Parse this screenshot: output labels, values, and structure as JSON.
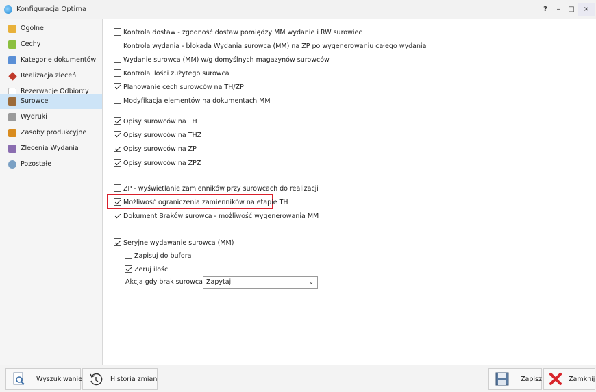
{
  "window": {
    "title": "Konfiguracja Optima",
    "help": "?",
    "minimize": "–",
    "maximize": "□",
    "close": "×"
  },
  "sidebar": {
    "items": [
      {
        "label": "Ogólne",
        "icon": "general-icon",
        "color": "#e8b13a"
      },
      {
        "label": "Cechy",
        "icon": "features-icon",
        "color": "#8bbf3f"
      },
      {
        "label": "Kategorie dokumentów",
        "icon": "document-categories-icon",
        "color": "#5a8fd6"
      },
      {
        "label": "Realizacja zleceń",
        "icon": "tools-icon",
        "color": "#c0392b"
      },
      {
        "label": "Rezerwacje Odbiorcy",
        "icon": "reservation-icon",
        "color": "#cfcfcf"
      },
      {
        "label": "Surowce",
        "icon": "raw-materials-icon",
        "color": "#9b6b3a",
        "active": true
      },
      {
        "label": "Wydruki",
        "icon": "printer-icon",
        "color": "#888"
      },
      {
        "label": "Zasoby produkcyjne",
        "icon": "resources-icon",
        "color": "#d98c1f"
      },
      {
        "label": "Zlecenia Wydania",
        "icon": "release-orders-icon",
        "color": "#8a6db0"
      },
      {
        "label": "Pozostałe",
        "icon": "other-icon",
        "color": "#7aa0c4"
      }
    ]
  },
  "options": [
    {
      "label": "Kontrola dostaw - zgodność dostaw pomiędzy MM wydanie i RW surowiec",
      "checked": false
    },
    {
      "label": "Kontrola wydania - blokada Wydania surowca (MM) na ZP po wygenerowaniu całego wydania",
      "checked": false
    },
    {
      "label": "Wydanie surowca (MM) w/g domyślnych magazynów surowców",
      "checked": false
    },
    {
      "label": "Kontrola ilości zużytego surowca",
      "checked": false
    },
    {
      "label": "Planowanie cech surowców na TH/ZP",
      "checked": true
    },
    {
      "label": "Modyfikacja elementów na dokumentach MM",
      "checked": false
    },
    {
      "label": "Opisy surowców na TH",
      "checked": true
    },
    {
      "label": "Opisy surowców na THZ",
      "checked": true
    },
    {
      "label": "Opisy surowców na ZP",
      "checked": true
    },
    {
      "label": "Opisy surowców na ZPZ",
      "checked": true
    },
    {
      "label": "ZP - wyświetlanie zamienników przy surowcach do realizacji",
      "checked": false
    },
    {
      "label": "Możliwość ograniczenia zamienników na etapie TH",
      "checked": true
    },
    {
      "label": "Dokument Braków surowca - możliwość wygenerowania MM",
      "checked": true
    },
    {
      "label": "Seryjne wydawanie surowca (MM)",
      "checked": true
    },
    {
      "label": "Zapisuj do bufora",
      "checked": false
    },
    {
      "label": "Zeruj ilości",
      "checked": true
    }
  ],
  "missing_action": {
    "label": "Akcja gdy brak surowca:",
    "value": "Zapytaj"
  },
  "bottom": {
    "search": "Wyszukiwanie",
    "history": "Historia zmian",
    "save": "Zapisz",
    "close": "Zamknij"
  },
  "colors": {
    "accent": "#cde4f7",
    "highlight": "#d9202c",
    "close_icon": "#d8262c",
    "save_icon": "#5a7aa0"
  }
}
